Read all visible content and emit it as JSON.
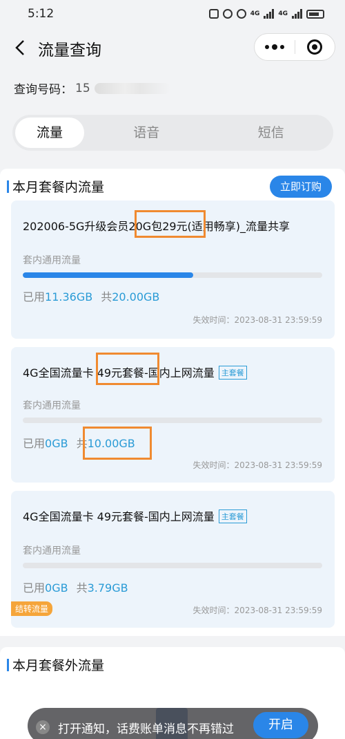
{
  "status_bar": {
    "time": "5:12",
    "net1": "4G",
    "net2": "4G"
  },
  "nav": {
    "title": "流量查询"
  },
  "query": {
    "label": "查询号码：",
    "value": "15"
  },
  "tabs": [
    {
      "label": "流量"
    },
    {
      "label": "语音"
    },
    {
      "label": "短信"
    }
  ],
  "section_main": {
    "title": "本月套餐内流量",
    "order_button": "立即订购"
  },
  "cards": [
    {
      "title": "202006-5G升级会员20G包29元(适用畅享)_流量共享",
      "sub": "套内通用流量",
      "used_label": "已用",
      "used": "11.36GB",
      "total_label": "共",
      "total": "20.00GB",
      "used_fraction": 0.568,
      "expire": "失效时间：2023-08-31 23:59:59"
    },
    {
      "title": "4G全国流量卡 49元套餐-国内上网流量",
      "tag": "主套餐",
      "sub": "套内通用流量",
      "used_label": "已用",
      "used": "0GB",
      "total_label": "共",
      "total": "10.00GB",
      "used_fraction": 0,
      "expire": "失效时间：2023-08-31 23:59:59"
    },
    {
      "title": "4G全国流量卡 49元套餐-国内上网流量",
      "tag": "主套餐",
      "sub": "套内通用流量",
      "used_label": "已用",
      "used": "0GB",
      "total_label": "共",
      "total": "3.79GB",
      "used_fraction": 0,
      "carry_tag": "结转流量",
      "expire": "失效时间：2023-08-31 23:59:59"
    }
  ],
  "section_extra": {
    "title": "本月套餐外流量"
  },
  "toast": {
    "close": "×",
    "text": "打开通知，话费账单消息不再错过",
    "button": "开启"
  },
  "colors": {
    "accent": "#2a86e8",
    "highlight": "#f08a30",
    "tag": "#2a9bd6",
    "carry": "#f5a53a"
  }
}
